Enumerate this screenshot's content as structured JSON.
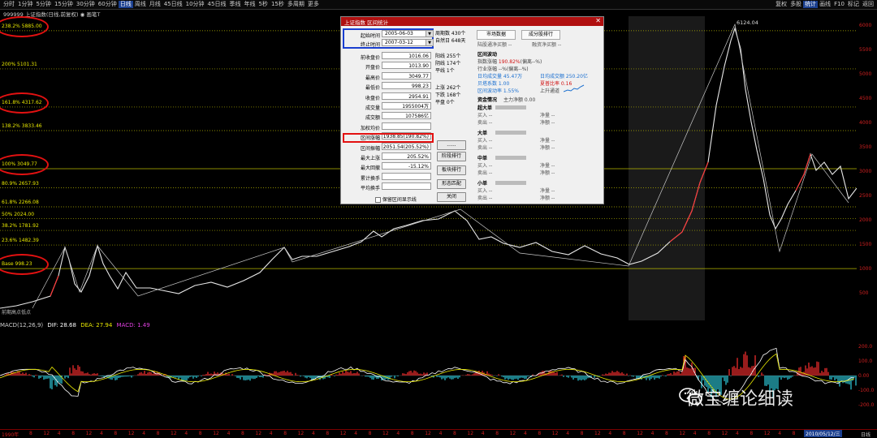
{
  "toolbar": {
    "tabs": [
      "分时",
      "1分钟",
      "5分钟",
      "15分钟",
      "30分钟",
      "60分钟",
      "日线",
      "周线",
      "月线",
      "45日线",
      "10分钟",
      "45日线",
      "季线",
      "年线",
      "5秒",
      "15秒",
      "多周期",
      "更多"
    ],
    "active_tab": "日线",
    "right_items": [
      "复权",
      "多股",
      "统计",
      "画线",
      "F10",
      "标记",
      "返回"
    ]
  },
  "chart_title": "999999  上证指数(日线,前复权)  ◉ 画笔T",
  "fib_levels": [
    {
      "label": "238.2% 5885.00",
      "value": 5885.0
    },
    {
      "label": "200% 5101.31",
      "value": 5101.31
    },
    {
      "label": "161.8% 4317.62",
      "value": 4317.62
    },
    {
      "label": "138.2% 3833.46",
      "value": 3833.46
    },
    {
      "label": "100% 3049.77",
      "value": 3049.77
    },
    {
      "label": "80.9% 2657.93",
      "value": 2657.93
    },
    {
      "label": "61.8% 2266.08",
      "value": 2266.08
    },
    {
      "label": "50% 2024.00",
      "value": 2024.0
    },
    {
      "label": "38.2% 1781.92",
      "value": 1781.92
    },
    {
      "label": "23.6% 1482.39",
      "value": 1482.39
    },
    {
      "label": "Base 998.23",
      "value": 998.23
    }
  ],
  "peak_label": "6124.04",
  "watermark_left": "前期高点低点",
  "y_axis_ticks": [
    "6000",
    "5500",
    "5000",
    "4500",
    "4000",
    "3500",
    "3000",
    "2500",
    "2000",
    "1500",
    "1000",
    "500"
  ],
  "macd": {
    "label_name": "MACD(12,26,9)",
    "dif": "DIF: 28.68",
    "dea": "DEA: 27.94",
    "macd": "MACD: 1.49",
    "y_ticks": [
      "200.0",
      "100.0",
      "0.00",
      "-100.0",
      "-200.0"
    ]
  },
  "x_axis": {
    "start": "1990年",
    "ticks": [
      "8",
      "12",
      "4",
      "8",
      "12",
      "4",
      "8",
      "12",
      "4",
      "8",
      "12",
      "4",
      "8",
      "12",
      "4",
      "8",
      "12",
      "4",
      "8",
      "12",
      "4",
      "8",
      "12",
      "4",
      "8",
      "12",
      "4",
      "8",
      "12",
      "4",
      "8",
      "12",
      "4",
      "8",
      "12",
      "4",
      "8",
      "12",
      "4",
      "8",
      "12",
      "4",
      "8",
      "12",
      "4",
      "8",
      "12",
      "4",
      "8",
      "12",
      "4",
      "8",
      "12",
      "4",
      "8",
      "12",
      "4",
      "8"
    ],
    "current_date": "2010/05/12/三",
    "right_label": "日线"
  },
  "dialog": {
    "title": "上证指数 区间统计",
    "start_label": "起始时间",
    "start_value": "2005-06-03",
    "end_label": "终止时间",
    "end_value": "2007-03-12",
    "fields": [
      {
        "label": "前收盘价",
        "value": "1016.06"
      },
      {
        "label": "开盘价",
        "value": "1013.90"
      },
      {
        "label": "最高价",
        "value": "3049.77"
      },
      {
        "label": "最低价",
        "value": "998.23"
      },
      {
        "label": "收盘价",
        "value": "2954.91"
      },
      {
        "label": "成交量",
        "value": "1955004万"
      },
      {
        "label": "成交额",
        "value": "107586亿"
      },
      {
        "label": "加权均价",
        "value": ""
      },
      {
        "label": "区间涨幅",
        "value": "1938.85(190.82%)"
      },
      {
        "label": "区间振幅",
        "value": "2051.54(205.52%)"
      },
      {
        "label": "最大上涨",
        "value": "205.52%"
      },
      {
        "label": "最大回撤",
        "value": "-15.12%"
      },
      {
        "label": "累计换手",
        "value": ""
      },
      {
        "label": "平均换手",
        "value": ""
      }
    ],
    "checkbox_label": "保留区间显示线",
    "period_stats": [
      "周期数 430个",
      "自然日 648天"
    ],
    "updown_stats": [
      "阳线 255个",
      "阴线 174个",
      "平线 1个"
    ],
    "rise_fall": [
      "上涨 262个",
      "下跌 168个",
      "平盘 0个"
    ],
    "buttons": [
      "......",
      "阶段排行",
      "板块排行",
      "形态匹配",
      "关闭"
    ],
    "tab_market": "市场数据",
    "tab_stock_rank": "成分股排行",
    "inflow_labels": [
      "陆股通净买额 --",
      "融资净买额 --"
    ],
    "range_title": "区间波动",
    "range_lines": [
      "指数涨幅 190.82%(偏离--%)",
      "行业涨幅 --%(偏离--%)",
      "日均成交量 45.47万",
      "贝塔系数 1.00",
      "区间波动率 1.55%"
    ],
    "range_right": [
      "日均成交额 250.20亿",
      "夏普比率 0.16",
      "上升通道"
    ],
    "funds_title": "资金情况",
    "funds_main": "主力净额 0.00",
    "fund_groups": [
      {
        "name": "超大单",
        "buy": "买入 --",
        "sell": "卖出 --",
        "net": "净量 --",
        "net2": "净额 --"
      },
      {
        "name": "大单",
        "buy": "买入 --",
        "sell": "卖出 --",
        "net": "净量 --",
        "net2": "净额 --"
      },
      {
        "name": "中单",
        "buy": "买入 --",
        "sell": "卖出 --",
        "net": "净量 --",
        "net2": "净额 --"
      },
      {
        "name": "小单",
        "buy": "买入 --",
        "sell": "卖出 --",
        "net": "净量 --",
        "net2": "净额 --"
      }
    ]
  },
  "brand_watermark": "微宝缠论细读",
  "colors": {
    "rise": "#ff3030",
    "fall": "#30d0e0",
    "fib": "#e8e800",
    "highlight": "#e31111",
    "dialog_title": "#b01010",
    "select_box": "#1a3fd0"
  }
}
